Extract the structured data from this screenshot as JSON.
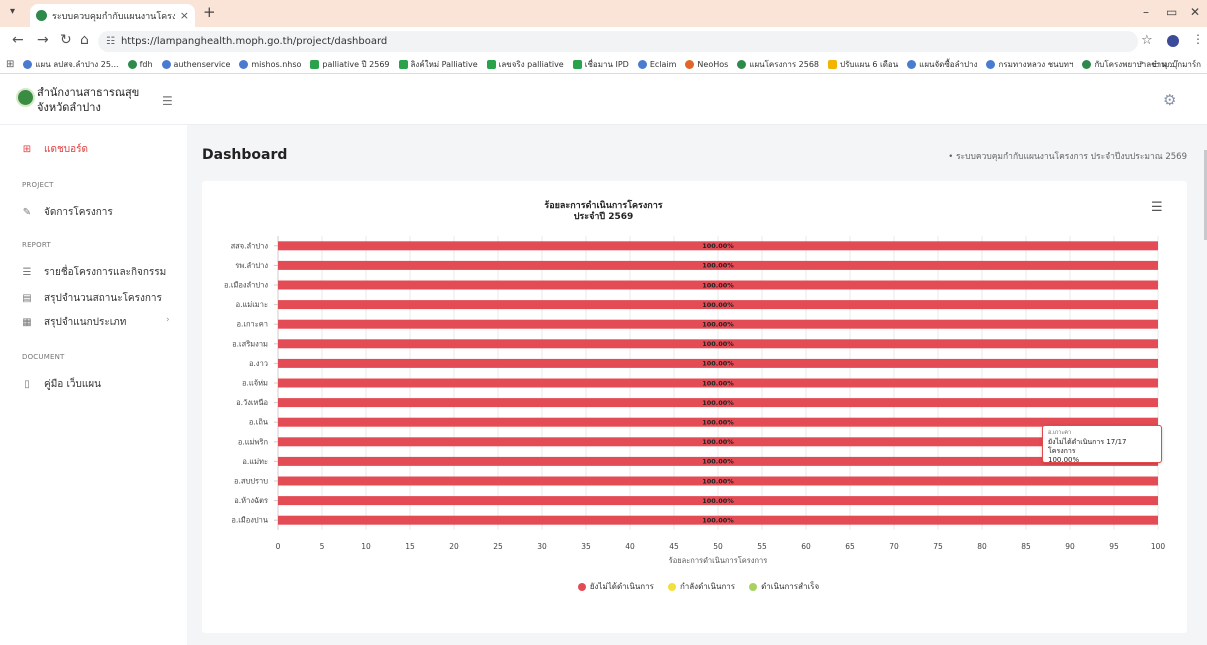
{
  "browser": {
    "tab_title": "ระบบควบคุมกำกับแผนงานโครงการ ประจำ",
    "url": "https://lampanghealth.moph.go.th/project/dashboard",
    "bookmarks": [
      {
        "label": "แผน ลปสจ.ลำปาง 25...",
        "icon": "b"
      },
      {
        "label": "fdh",
        "icon": "g"
      },
      {
        "label": "authenservice",
        "icon": "b"
      },
      {
        "label": "mishos.nhso",
        "icon": "b"
      },
      {
        "label": "palliative ปี 2569",
        "icon": "s"
      },
      {
        "label": "ลิงค์ใหม่ Palliative",
        "icon": "s"
      },
      {
        "label": "เลขจริง palliative",
        "icon": "s"
      },
      {
        "label": "เชื่อมาน IPD",
        "icon": "s"
      },
      {
        "label": "Eclaim",
        "icon": "b"
      },
      {
        "label": "NeoHos",
        "icon": "o"
      },
      {
        "label": "แผนโครงการ 2568",
        "icon": "g"
      },
      {
        "label": "ปรับแผน 6 เดือน",
        "icon": "y"
      },
      {
        "label": "แผนจัดซื้อลำปาง",
        "icon": "b"
      },
      {
        "label": "กรมทางหลวง ชนบทฯ",
        "icon": "b"
      },
      {
        "label": "กับโครงพยาบาลชำน...",
        "icon": "g"
      }
    ],
    "bookmarks_more": "»",
    "bookmarks_folder": "ทุกบุ๊กมาร์ก"
  },
  "app": {
    "org_line1": "สำนักงานสาธารณสุข",
    "org_line2": "จังหวัดลำปาง"
  },
  "sidebar": {
    "dashboard": "แดชบอร์ด",
    "sec_project": "PROJECT",
    "manage": "จัดการโครงการ",
    "sec_report": "REPORT",
    "report1": "รายชื่อโครงการและกิจกรรม",
    "report2": "สรุปจำนวนสถานะโครงการ",
    "report3": "สรุปจำแนกประเภท",
    "sec_document": "DOCUMENT",
    "manual": "คู่มือ เว็บแผน"
  },
  "page": {
    "title": "Dashboard",
    "breadcrumb": "ระบบควบคุมกำกับแผนงานโครงการ ประจำปีงบประมาณ 2569"
  },
  "tooltip": {
    "head": "อ.เกาะคา",
    "line1": "ยังไม่ได้ดำเนินการ 17/17 โครงการ",
    "line2": "100.00%"
  },
  "colors": {
    "not_started": "#e44c55",
    "in_progress": "#f3e03b",
    "completed": "#a8d160"
  },
  "chart_data": {
    "type": "bar",
    "orientation": "horizontal",
    "stacked": true,
    "title": "ร้อยละการดำเนินการโครงการ",
    "subtitle": "ประจำปี 2569",
    "xlabel": "ร้อยละการดำเนินการโครงการ",
    "xlim": [
      0,
      100
    ],
    "xticks": [
      0,
      5,
      10,
      15,
      20,
      25,
      30,
      35,
      40,
      45,
      50,
      55,
      60,
      65,
      70,
      75,
      80,
      85,
      90,
      95,
      100
    ],
    "categories": [
      "สสจ.ลำปาง",
      "รพ.ลำปาง",
      "อ.เมืองลำปาง",
      "อ.แม่เมาะ",
      "อ.เกาะคา",
      "อ.เสริมงาม",
      "อ.งาว",
      "อ.แจ้ห่ม",
      "อ.วังเหนือ",
      "อ.เถิน",
      "อ.แม่พริก",
      "อ.แม่ทะ",
      "อ.สบปราบ",
      "อ.ห้างฉัตร",
      "อ.เมืองปาน"
    ],
    "series": [
      {
        "name": "ยังไม่ได้ดำเนินการ",
        "values": [
          100,
          100,
          100,
          100,
          100,
          100,
          100,
          100,
          100,
          100,
          100,
          100,
          100,
          100,
          100
        ]
      },
      {
        "name": "กำลังดำเนินการ",
        "values": [
          0,
          0,
          0,
          0,
          0,
          0,
          0,
          0,
          0,
          0,
          0,
          0,
          0,
          0,
          0
        ]
      },
      {
        "name": "ดำเนินการสำเร็จ",
        "values": [
          0,
          0,
          0,
          0,
          0,
          0,
          0,
          0,
          0,
          0,
          0,
          0,
          0,
          0,
          0
        ]
      }
    ],
    "data_labels": [
      "100.00%",
      "100.00%",
      "100.00%",
      "100.00%",
      "100.00%",
      "100.00%",
      "100.00%",
      "100.00%",
      "100.00%",
      "100.00%",
      "100.00%",
      "100.00%",
      "100.00%",
      "100.00%",
      "100.00%"
    ],
    "legend_position": "bottom-center",
    "grid": true
  }
}
